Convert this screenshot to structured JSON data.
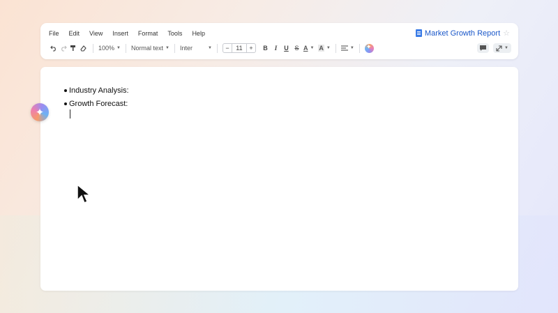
{
  "menu": [
    "File",
    "Edit",
    "View",
    "Insert",
    "Format",
    "Tools",
    "Help"
  ],
  "document": {
    "title": "Market Growth Report"
  },
  "toolbar": {
    "zoom": "100%",
    "style": "Normal text",
    "font": "Inter",
    "font_size": "11",
    "minus": "−",
    "plus": "+",
    "bold": "B",
    "italic": "I",
    "underline": "U",
    "strike": "S",
    "text_color": "A",
    "highlight": "A"
  },
  "content": {
    "bullets": [
      "Industry Analysis:",
      "Growth Forecast:"
    ]
  },
  "colors": {
    "accent": "#1a57c9",
    "doc_icon": "#3a7be6"
  },
  "icons": [
    "undo-icon",
    "redo-icon",
    "paint-format-icon",
    "clear-format-icon",
    "align-icon",
    "gemini-icon",
    "comment-icon",
    "expand-icon",
    "star-icon",
    "mouse-pointer-icon"
  ]
}
